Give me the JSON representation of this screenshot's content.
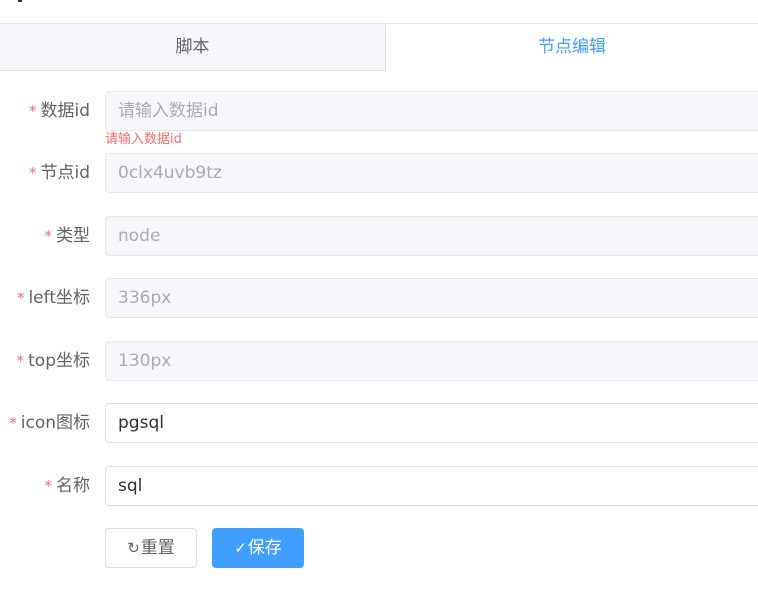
{
  "tabs": [
    {
      "label": "脚本",
      "active": false
    },
    {
      "label": "节点编辑",
      "active": true
    }
  ],
  "form": {
    "required_mark": "*",
    "fields": {
      "data_id": {
        "label": "数据id",
        "value": "",
        "placeholder": "请输入数据id",
        "error": "请输入数据id",
        "disabled": true
      },
      "node_id": {
        "label": "节点id",
        "value": "0clx4uvb9tz",
        "disabled": true
      },
      "type": {
        "label": "类型",
        "value": "node",
        "disabled": true
      },
      "left": {
        "label": "left坐标",
        "value": "336px",
        "disabled": true
      },
      "top": {
        "label": "top坐标",
        "value": "130px",
        "disabled": true
      },
      "icon": {
        "label": "icon图标",
        "value": "pgsql",
        "disabled": false
      },
      "name": {
        "label": "名称",
        "value": "sql",
        "disabled": false
      }
    },
    "buttons": {
      "reset": {
        "label": "重置",
        "icon": "refresh-icon",
        "glyph": "↻"
      },
      "save": {
        "label": "保存",
        "icon": "check-icon",
        "glyph": "✓"
      }
    }
  },
  "colors": {
    "primary": "#409eff",
    "danger": "#f56c6c",
    "text_regular": "#606266",
    "placeholder": "#a8abb2",
    "disabled_bg": "#f5f7fa"
  }
}
